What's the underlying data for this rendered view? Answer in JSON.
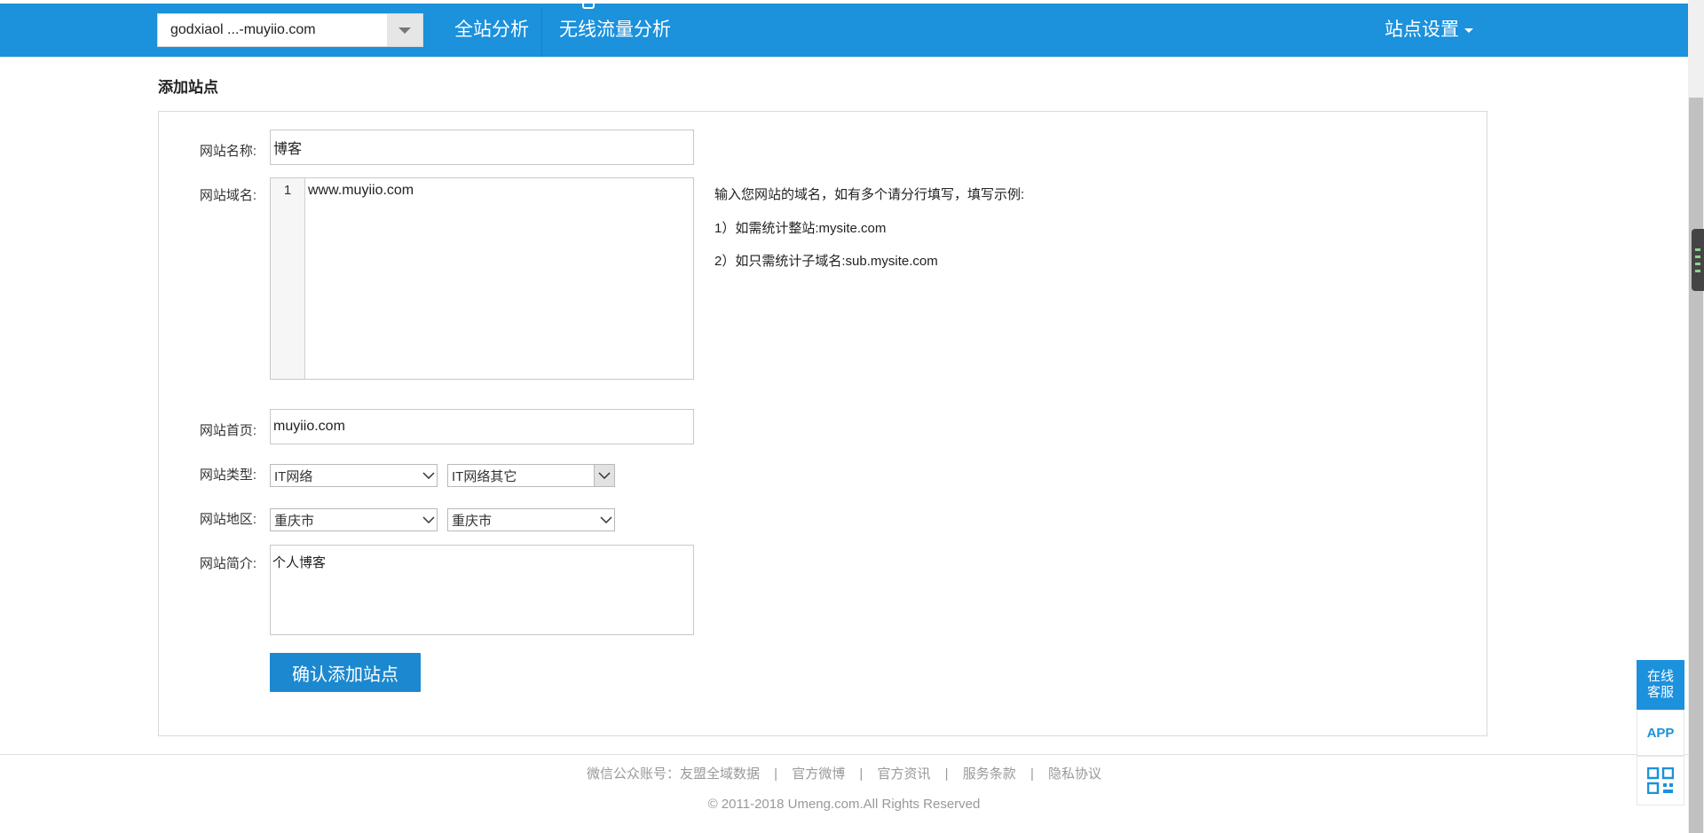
{
  "header": {
    "site_select_value": "godxiaol ...-muyiio.com",
    "nav_all_site": "全站分析",
    "nav_wireless": "无线流量分析",
    "nav_settings": "站点设置"
  },
  "page": {
    "title": "添加站点"
  },
  "form": {
    "name_label": "网站名称:",
    "name_value": "博客",
    "domain_label": "网站域名:",
    "domain_line_number": "1",
    "domain_value": "www.muyiio.com",
    "domain_hint_title": "输入您网站的域名，如有多个请分行填写，填写示例:",
    "domain_hint_1": "1）如需统计整站:mysite.com",
    "domain_hint_2": "2）如只需统计子域名:sub.mysite.com",
    "homepage_label": "网站首页:",
    "homepage_value": "muyiio.com",
    "type_label": "网站类型:",
    "type_primary": "IT网络",
    "type_secondary": "IT网络其它",
    "region_label": "网站地区:",
    "region_province": "重庆市",
    "region_city": "重庆市",
    "intro_label": "网站简介:",
    "intro_value": "个人博客",
    "submit_label": "确认添加站点"
  },
  "footer": {
    "wechat": "微信公众账号：友盟全域数据",
    "weibo": "官方微博",
    "news": "官方资讯",
    "terms": "服务条款",
    "privacy": "隐私协议",
    "separator": "|",
    "copyright": "© 2011-2018 Umeng.com.All Rights Reserved"
  },
  "floating": {
    "service_line1": "在线",
    "service_line2": "客服",
    "app": "APP"
  },
  "icons": {
    "dropdown": "chevron-down-icon",
    "qr": "qr-code-icon"
  },
  "colors": {
    "header_bg": "#1c91dc",
    "button_bg": "#1c88cf"
  }
}
